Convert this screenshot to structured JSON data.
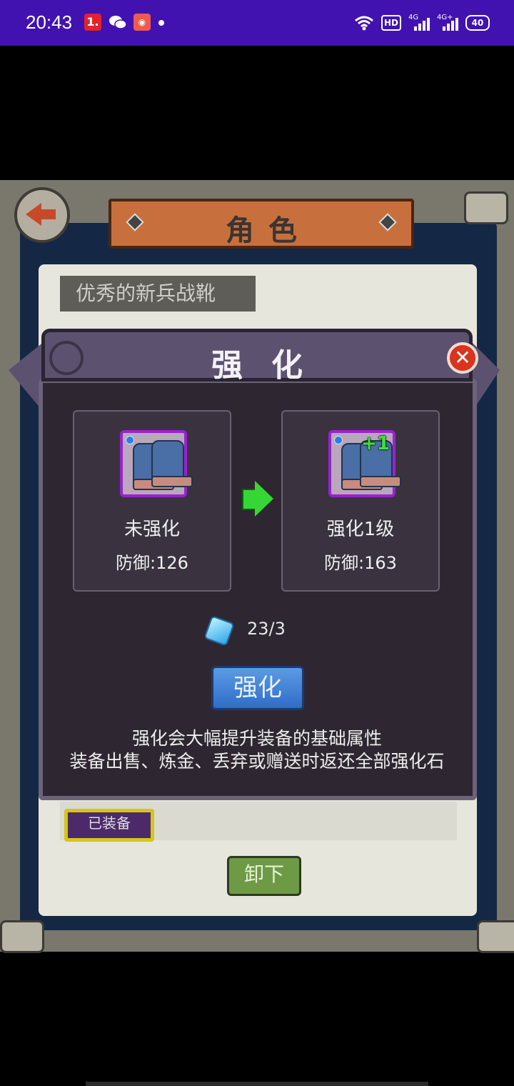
{
  "status_bar": {
    "time": "20:43",
    "notification_1": "1.",
    "signal_1": "4G",
    "signal_2": "4G+",
    "hd_label": "HD",
    "battery": "40"
  },
  "screen": {
    "title": "角色",
    "item_name": "优秀的新兵战靴",
    "equipped_badge": "已装备",
    "unload_button": "卸下"
  },
  "enhance_dialog": {
    "title": "强化",
    "close_icon": "close-icon",
    "current": {
      "level_label": "未强化",
      "stat": "防御:126"
    },
    "next": {
      "level_label": "强化1级",
      "stat": "防御:163",
      "badge": "+1"
    },
    "stone_count": "23/3",
    "enhance_button": "强化",
    "info_lines": [
      "强化会大幅提升装备的基础属性",
      "装备出售、炼金、丢弃或赠送时返还全部强化石"
    ]
  },
  "colors": {
    "status_bar": "#4212b0",
    "dialog_bg": "#2e2731",
    "item_rarity_border": "#9a22d0",
    "arrow": "#37d637",
    "enhance_button": "#2f6dc7",
    "close_button": "#d8341e"
  }
}
